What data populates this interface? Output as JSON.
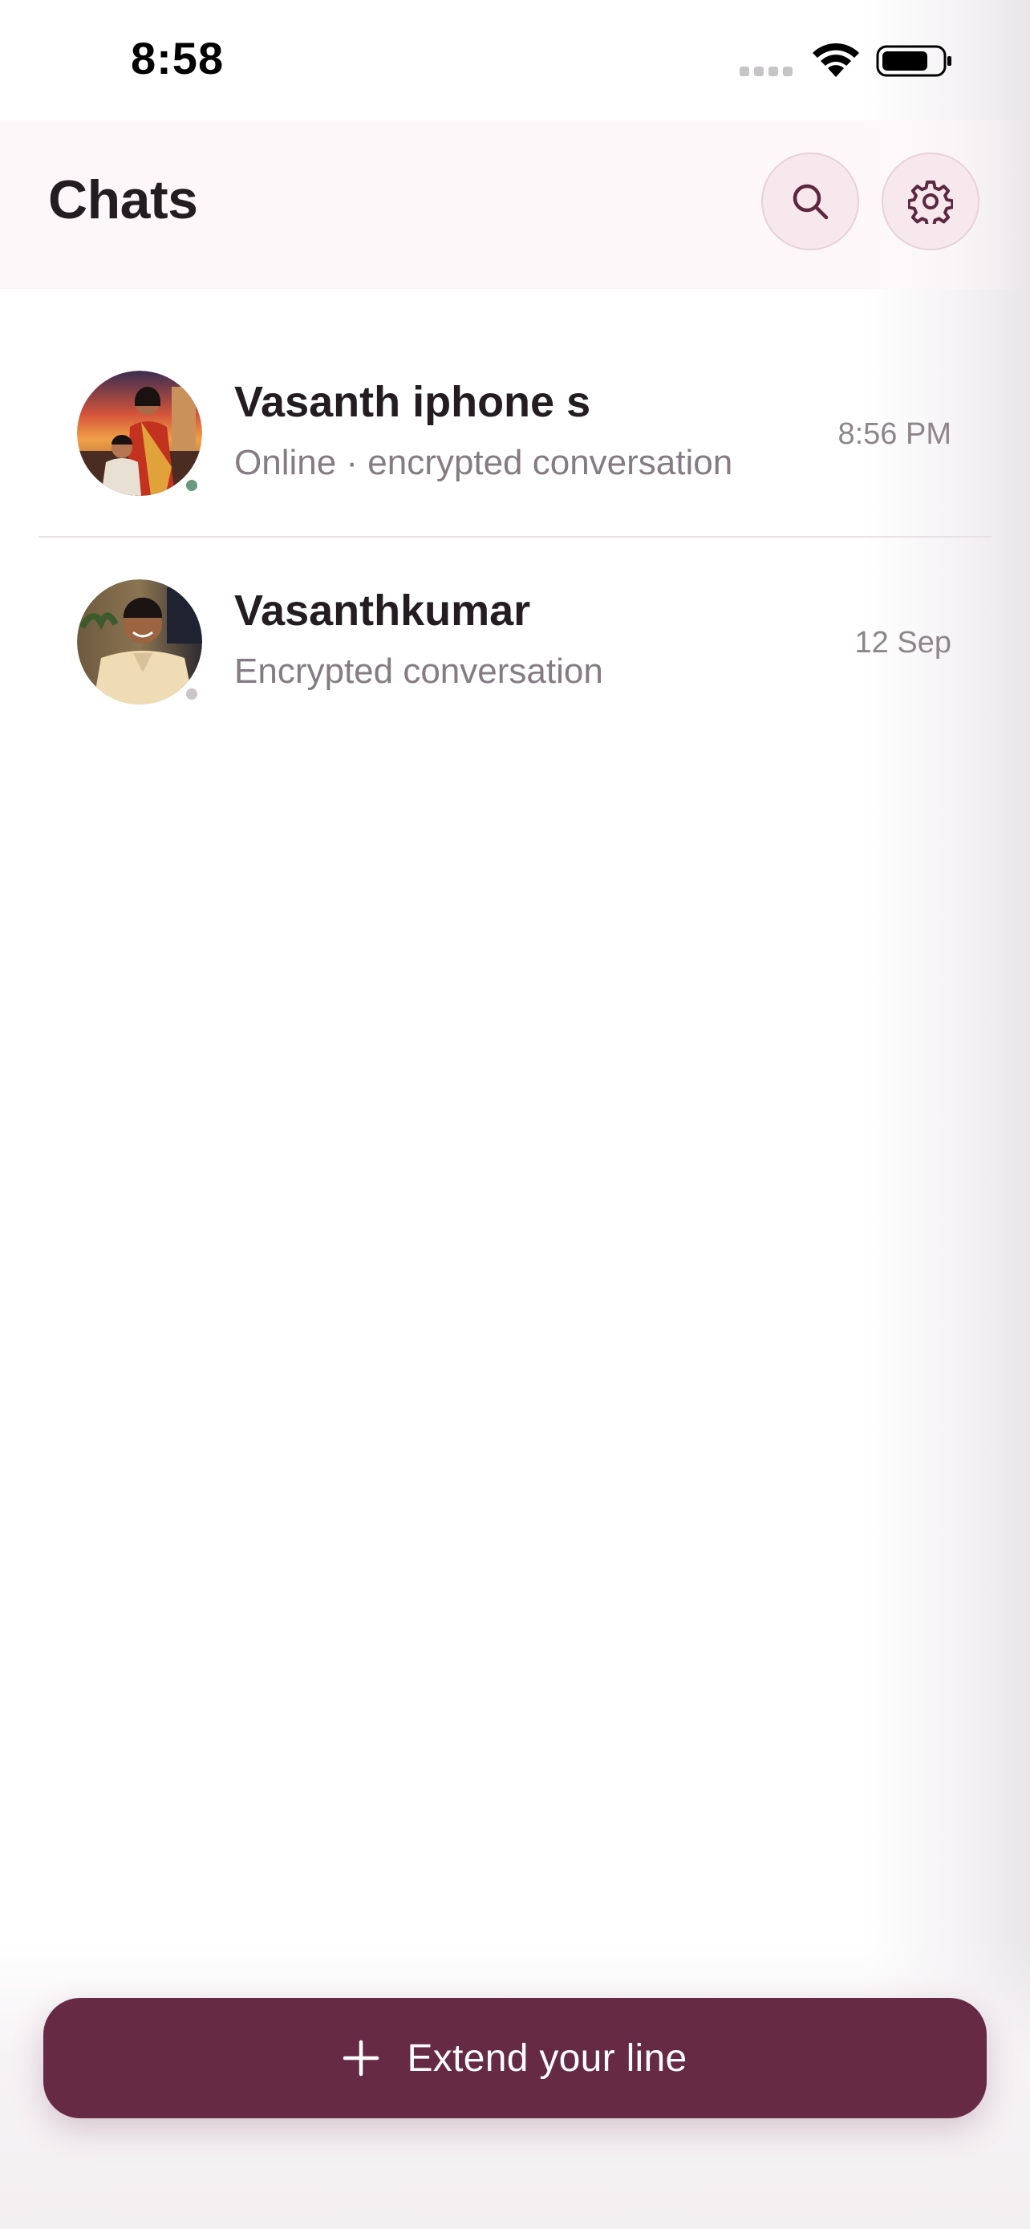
{
  "status_bar": {
    "time": "8:58"
  },
  "header": {
    "title": "Chats",
    "search_icon": "search-icon",
    "settings_icon": "gear-icon"
  },
  "chats": [
    {
      "name": "Vasanth iphone s",
      "preview": "Online · encrypted conversation",
      "time": "8:56 PM",
      "online": true,
      "presence_color": "#6a9a7e"
    },
    {
      "name": "Vasanthkumar",
      "preview": "Encrypted conversation",
      "time": "12 Sep",
      "online": false,
      "presence_color": "#c9c5c8"
    }
  ],
  "footer": {
    "button_label": "Extend your line",
    "button_icon": "plus-icon"
  },
  "colors": {
    "accent": "#662a44",
    "header_bg": "#fdf7f9",
    "icon_button_bg": "#f6e8ec"
  }
}
